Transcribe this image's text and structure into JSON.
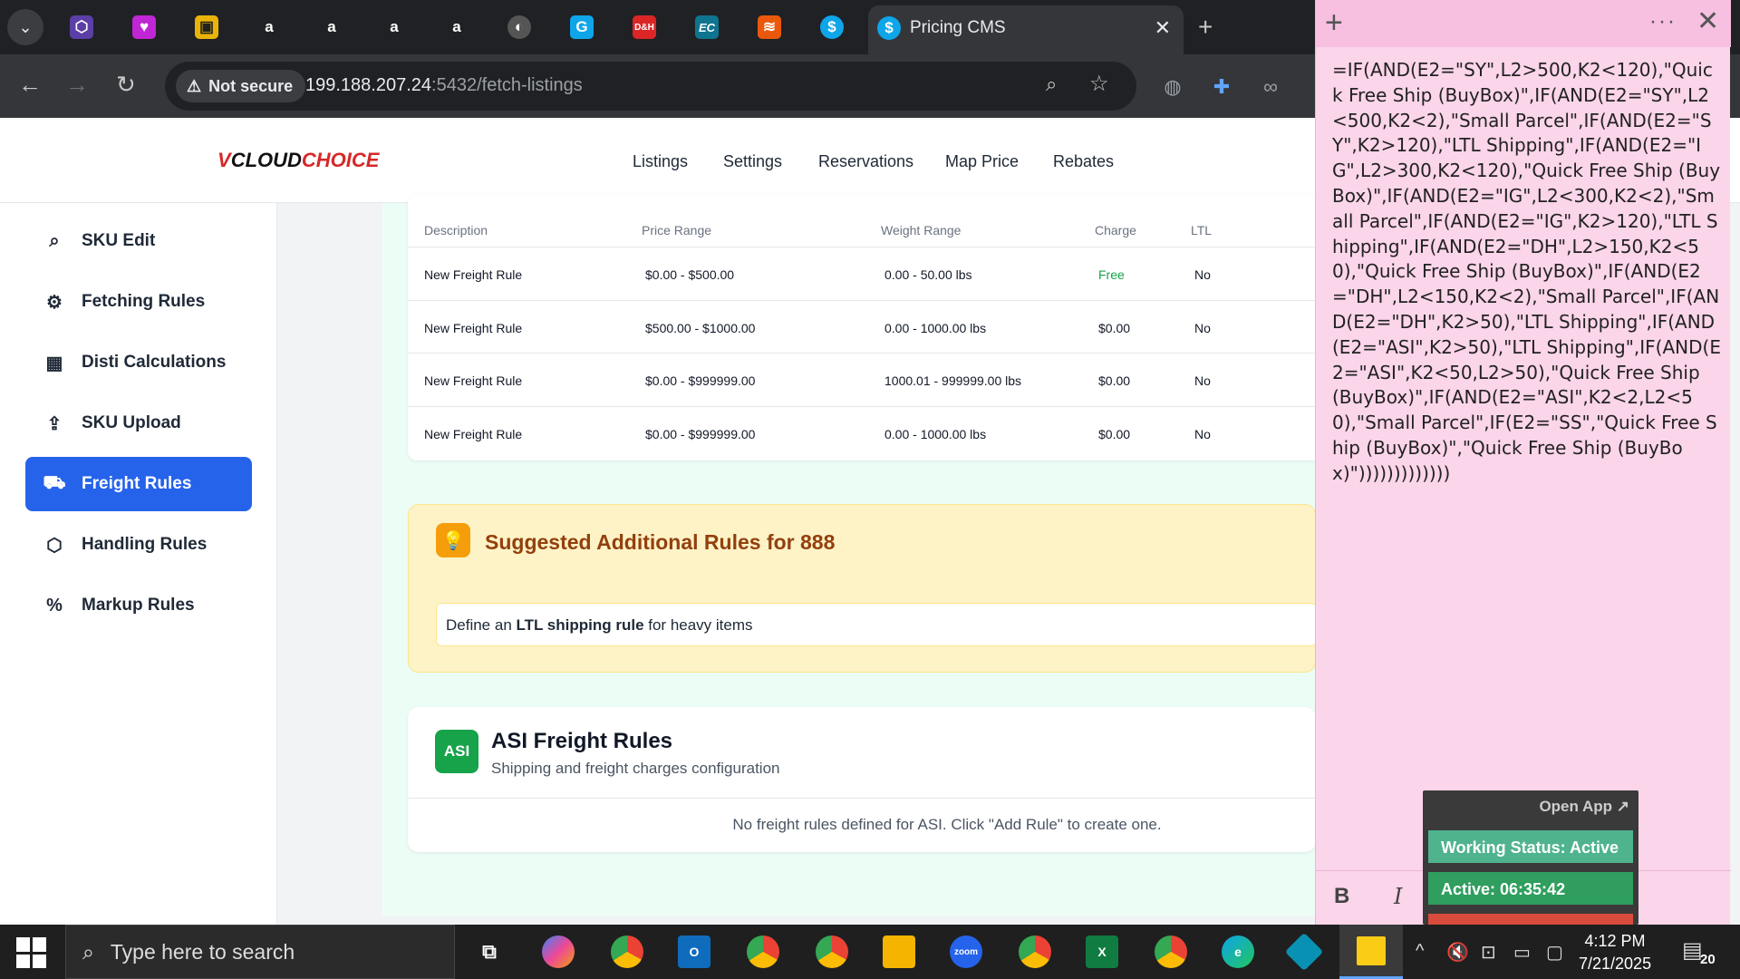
{
  "browser": {
    "active_tab_title": "Pricing CMS",
    "security_label": "Not secure",
    "url_host": "199.188.207.24",
    "url_rest": ":5432/fetch-listings"
  },
  "site": {
    "logo_prefix": "V",
    "logo_cloud": "CLOUD",
    "logo_choice": "CHOICE",
    "nav": [
      "Listings",
      "Settings",
      "Reservations",
      "Map Price",
      "Rebates"
    ]
  },
  "sidebar": {
    "items": [
      {
        "label": "SKU Edit",
        "icon": "search-icon"
      },
      {
        "label": "Fetching Rules",
        "icon": "gear-icon"
      },
      {
        "label": "Disti Calculations",
        "icon": "calculator-icon"
      },
      {
        "label": "SKU Upload",
        "icon": "upload-icon"
      },
      {
        "label": "Freight Rules",
        "icon": "truck-icon",
        "active": true
      },
      {
        "label": "Handling Rules",
        "icon": "box-icon"
      },
      {
        "label": "Markup Rules",
        "icon": "percent-icon"
      }
    ]
  },
  "freight_table": {
    "headers": [
      "Description",
      "Price Range",
      "Weight Range",
      "Charge",
      "LTL"
    ],
    "rows": [
      [
        "New Freight Rule",
        "$0.00 - $500.00",
        "0.00 - 50.00 lbs",
        "Free",
        "No"
      ],
      [
        "New Freight Rule",
        "$500.00 - $1000.00",
        "0.00 - 1000.00 lbs",
        "$0.00",
        "No"
      ],
      [
        "New Freight Rule",
        "$0.00 - $999999.00",
        "1000.01 - 999999.00 lbs",
        "$0.00",
        "No"
      ],
      [
        "New Freight Rule",
        "$0.00 - $999999.00",
        "0.00 - 1000.00 lbs",
        "$0.00",
        "No"
      ]
    ]
  },
  "suggestions": {
    "title": "Suggested Additional Rules for 888",
    "item_prefix": "Define an ",
    "item_bold": "LTL shipping rule",
    "item_suffix": " for heavy items"
  },
  "asi": {
    "badge": "ASI",
    "title": "ASI Freight Rules",
    "subtitle": "Shipping and freight charges configuration",
    "empty": "No freight rules defined for ASI. Click \"Add Rule\" to create one."
  },
  "sticky_note": {
    "text": "=IF(AND(E2=\"SY\",L2>500,K2<120),\"Quick Free Ship (BuyBox)\",IF(AND(E2=\"SY\",L2<500,K2<2),\"Small Parcel\",IF(AND(E2=\"SY\",K2>120),\"LTL Shipping\",IF(AND(E2=\"IG\",L2>300,K2<120),\"Quick Free Ship (BuyBox)\",IF(AND(E2=\"IG\",L2<300,K2<2),\"Small Parcel\",IF(AND(E2=\"IG\",K2>120),\"LTL Shipping\",IF(AND(E2=\"DH\",L2>150,K2<50),\"Quick Free Ship (BuyBox)\",IF(AND(E2=\"DH\",L2<150,K2<2),\"Small Parcel\",IF(AND(E2=\"DH\",K2>50),\"LTL Shipping\",IF(AND(E2=\"ASI\",K2>50),\"LTL Shipping\",IF(AND(E2=\"ASI\",K2<50,L2>50),\"Quick Free Ship (BuyBox)\",IF(AND(E2=\"ASI\",K2<2,L2<50),\"Small Parcel\",IF(E2=\"SS\",\"Quick Free Ship (BuyBox)\",\"Quick Free Ship (BuyBox)\")))))))))))))",
    "bold": "B",
    "italic": "I"
  },
  "widget": {
    "open_app": "Open App ↗",
    "status": "Working Status: Active",
    "active": "Active: 06:35:42"
  },
  "taskbar": {
    "search_placeholder": "Type here to search",
    "time": "4:12 PM",
    "date": "7/21/2025",
    "notifications": "20"
  }
}
